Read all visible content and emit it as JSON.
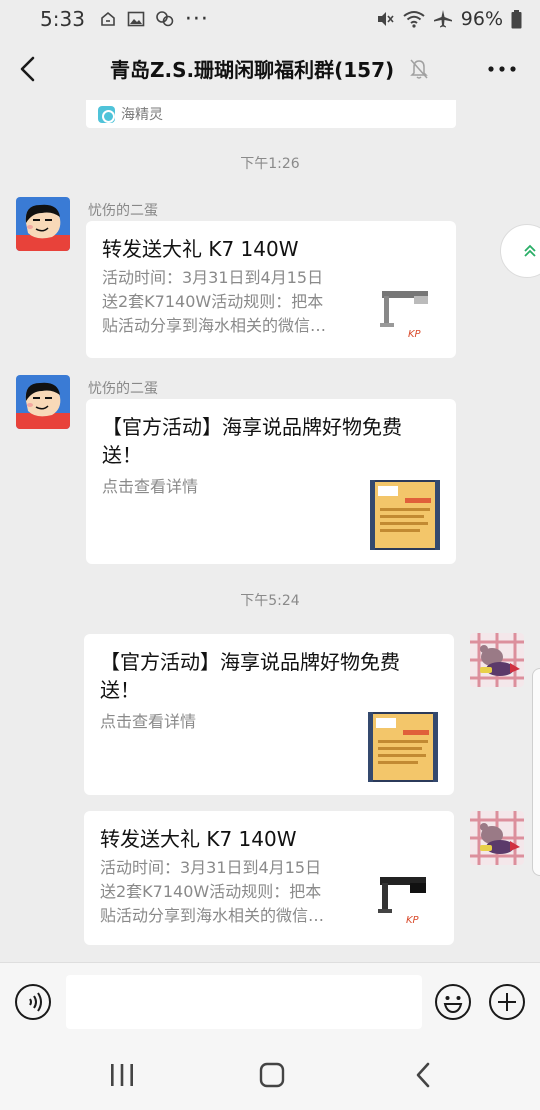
{
  "status": {
    "time": "5:33",
    "dots": "···",
    "battery": "96%"
  },
  "header": {
    "title": "青岛Z.S.珊瑚闲聊福利群(157)"
  },
  "partial_card": {
    "source": "海精灵"
  },
  "timestamps": [
    "下午1:26",
    "下午5:24"
  ],
  "messages": [
    {
      "sender": "忧伤的二蛋",
      "title": "转发送大礼 K7 140W",
      "desc_lines": [
        "活动时间：3月31日到4月15日",
        "送2套K7140W活动规则：把本",
        "贴活动分享到海水相关的微信…"
      ]
    },
    {
      "sender": "忧伤的二蛋",
      "title_lines": [
        "【官方活动】海享说品牌好物免费",
        "送！"
      ],
      "desc": "点击查看详情"
    },
    {
      "title_lines": [
        "【官方活动】海享说品牌好物免费",
        "送！"
      ],
      "desc": "点击查看详情"
    },
    {
      "title": "转发送大礼 K7 140W",
      "desc_lines": [
        "活动时间：3月31日到4月15日",
        "送2套K7140W活动规则：把本",
        "贴活动分享到海水相关的微信…"
      ]
    }
  ],
  "thumb_logo": "KP",
  "colors": {
    "background": "#ededed",
    "card": "#ffffff",
    "muted_text": "#8a8a8a",
    "float_arrow": "#2aae67"
  }
}
